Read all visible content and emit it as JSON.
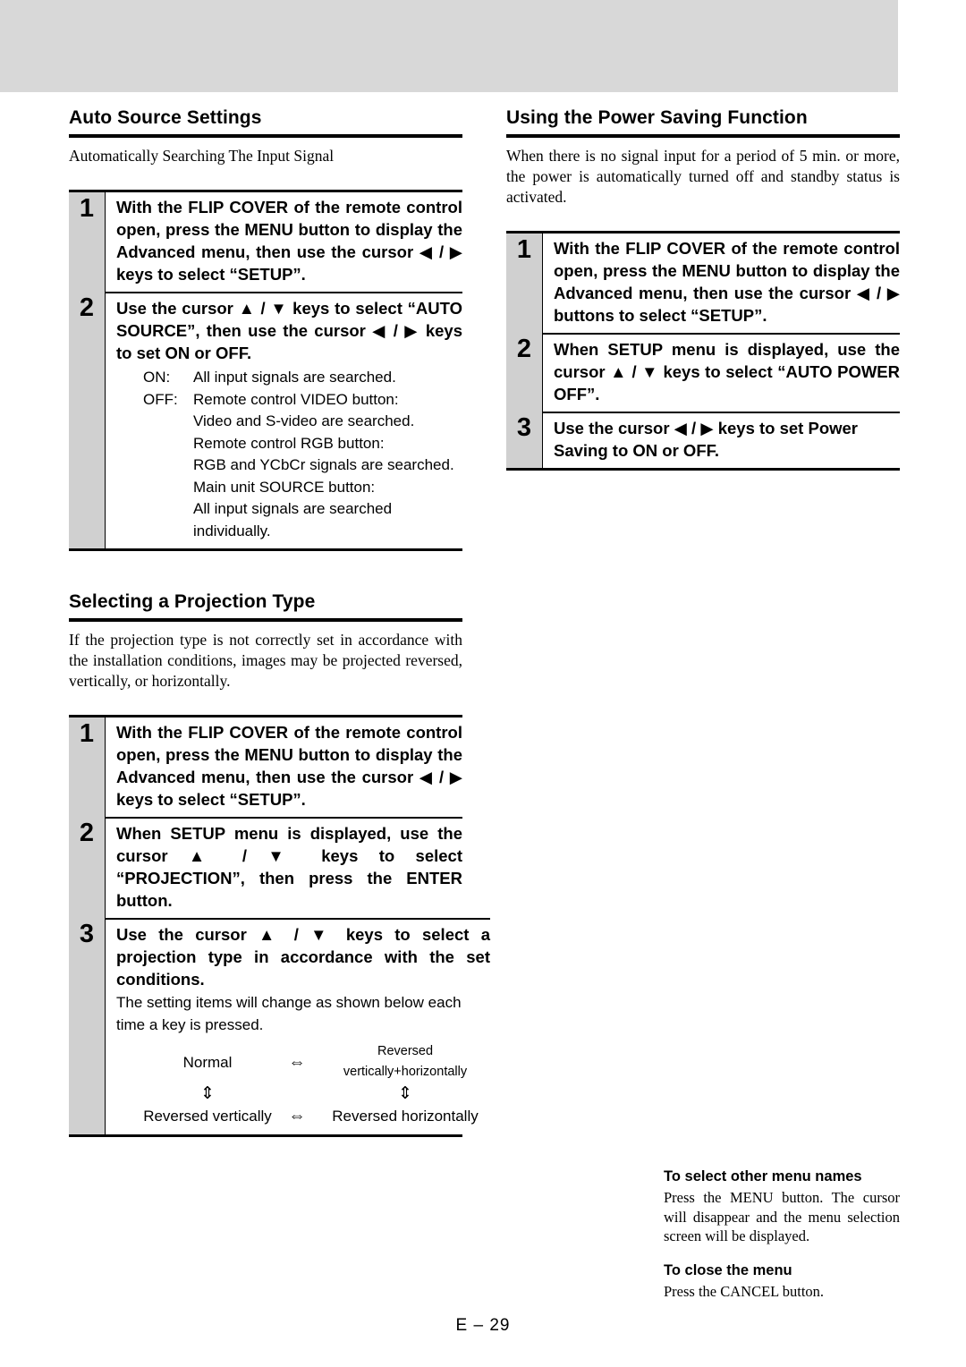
{
  "page": {
    "footer": "E – 29"
  },
  "left_column": {
    "section1": {
      "heading": "Auto Source Settings",
      "intro": "Automatically Searching The Input Signal",
      "steps": [
        {
          "number": "1",
          "title": "With the FLIP COVER of the remote control open, press the MENU button to display the Advanced menu, then use the cursor ◀ / ▶ keys to select “SETUP”."
        },
        {
          "number": "2",
          "title": "Use the cursor ▲ / ▼ keys to select “AUTO SOURCE”, then use the cursor ◀ / ▶ keys to set ON or OFF.",
          "definitions": [
            {
              "key": "ON:",
              "value": "All input signals are searched."
            },
            {
              "key": "OFF:",
              "value": "Remote control VIDEO button:"
            }
          ],
          "definition_subs": [
            "Video and S-video are searched.",
            "Remote control RGB button:",
            "RGB and YCbCr signals are searched.",
            "Main unit SOURCE button:",
            "All input signals are searched individually."
          ]
        }
      ]
    },
    "section2": {
      "heading": "Selecting a Projection Type",
      "intro": "If the projection type is not correctly set in accordance with the installation conditions, images may be projected reversed, vertically, or horizontally.",
      "steps": [
        {
          "number": "1",
          "title": "With the FLIP COVER of the remote control open, press the MENU button to display the Advanced menu, then use the cursor ◀ / ▶ keys to select “SETUP”."
        },
        {
          "number": "2",
          "title": "When SETUP menu is displayed, use the cursor ▲ / ▼ keys to select “PROJECTION”, then press the ENTER button."
        },
        {
          "number": "3",
          "title": "Use the cursor ▲ / ▼ keys to select a projection type in accordance with the set conditions.",
          "note": "The setting items will change as shown below each time a key is pressed.",
          "cycle": {
            "top_left": "Normal",
            "top_arrow": "⇔",
            "top_right": "Reversed vertically+horizontally",
            "left_arrow": "⇕",
            "right_arrow": "⇕",
            "bottom_left": "Reversed vertically",
            "bottom_arrow": "⇔",
            "bottom_right": "Reversed horizontally"
          }
        }
      ]
    }
  },
  "right_column": {
    "section1": {
      "heading": "Using the Power Saving Function",
      "intro": "When there is no signal input for a period of 5 min. or more, the power is automatically turned off and standby status is activated.",
      "steps": [
        {
          "number": "1",
          "title": "With the FLIP COVER of the remote control open, press the MENU button to display the Advanced menu, then use the cursor ◀ / ▶ buttons to select “SETUP”."
        },
        {
          "number": "2",
          "title": "When SETUP menu is displayed, use the cursor ▲ / ▼ keys to select “AUTO POWER OFF”."
        },
        {
          "number": "3",
          "title": "Use the cursor ◀ / ▶ keys to set Power Saving to ON or OFF."
        }
      ]
    },
    "notes": {
      "head1": "To select other menu names",
      "body1": "Press the MENU button. The cursor will disappear and the menu selection screen will be displayed.",
      "head2": "To close the menu",
      "body2": "Press the CANCEL button."
    }
  }
}
